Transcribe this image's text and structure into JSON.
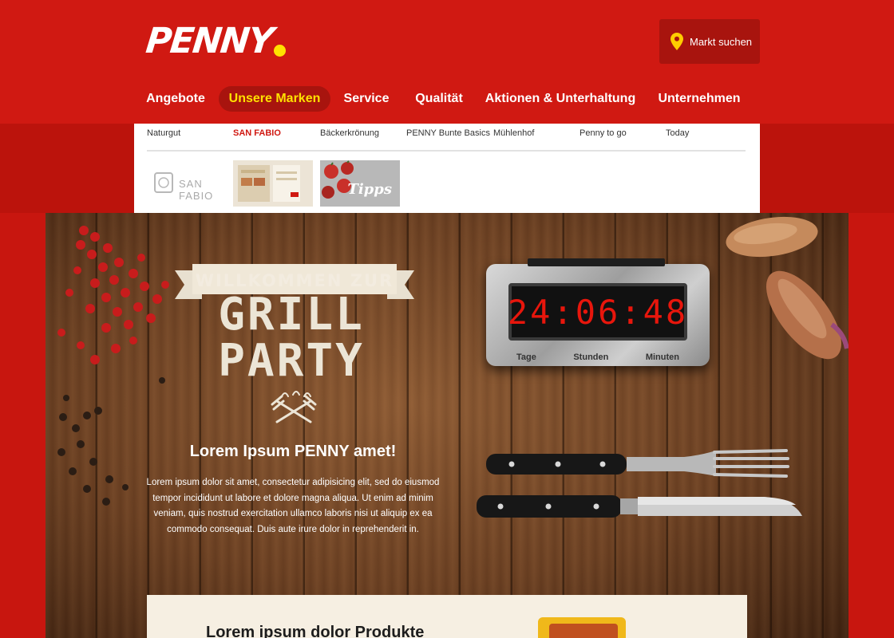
{
  "brand": {
    "logo_text": "PENNY"
  },
  "header": {
    "store_finder_label": "Markt suchen",
    "nav": [
      {
        "label": "Angebote",
        "active": false
      },
      {
        "label": "Unsere Marken",
        "active": true
      },
      {
        "label": "Service",
        "active": false
      },
      {
        "label": "Qualität",
        "active": false
      },
      {
        "label": "Aktionen & Unterhaltung",
        "active": false
      },
      {
        "label": "Unternehmen",
        "active": false
      }
    ]
  },
  "submenu": {
    "items": [
      {
        "label": "Naturgut",
        "active": false
      },
      {
        "label": "SAN FABIO",
        "active": true
      },
      {
        "label": "Bäckerkrönung",
        "active": false
      },
      {
        "label": "PENNY Bunte Basics",
        "active": false
      },
      {
        "label": "Mühlenhof",
        "active": false
      },
      {
        "label": "Penny to go",
        "active": false
      },
      {
        "label": "Today",
        "active": false
      }
    ],
    "thumbnails": {
      "san_fabio_logo": "SAN FABIO",
      "prospekt": "",
      "tipps": "Tipps"
    }
  },
  "hero": {
    "banner": "WILLKOMMEN ZUR",
    "headline_line1": "GRILL",
    "headline_line2": "PARTY",
    "title": "Lorem Ipsum PENNY amet!",
    "body": "Lorem ipsum dolor sit amet, consectetur adipisicing elit, sed do eiusmod tempor incididunt ut labore et dolore magna aliqua. Ut enim ad minim veniam, quis nostrud exercitation ullamco laboris nisi ut aliquip ex ea commodo consequat. Duis aute irure dolor in reprehenderit in.",
    "countdown": {
      "display": "24:06:48",
      "labels": [
        "Tage",
        "Stunden",
        "Minuten"
      ]
    }
  },
  "products": {
    "title": "Lorem ipsum dolor Produkte"
  },
  "colors": {
    "brand_red": "#d01912",
    "dark_red": "#a8140e",
    "brand_yellow": "#ffe100",
    "countdown_red": "#e8160c"
  },
  "icons": [
    "map-pin-icon",
    "grill-tools-icon"
  ]
}
